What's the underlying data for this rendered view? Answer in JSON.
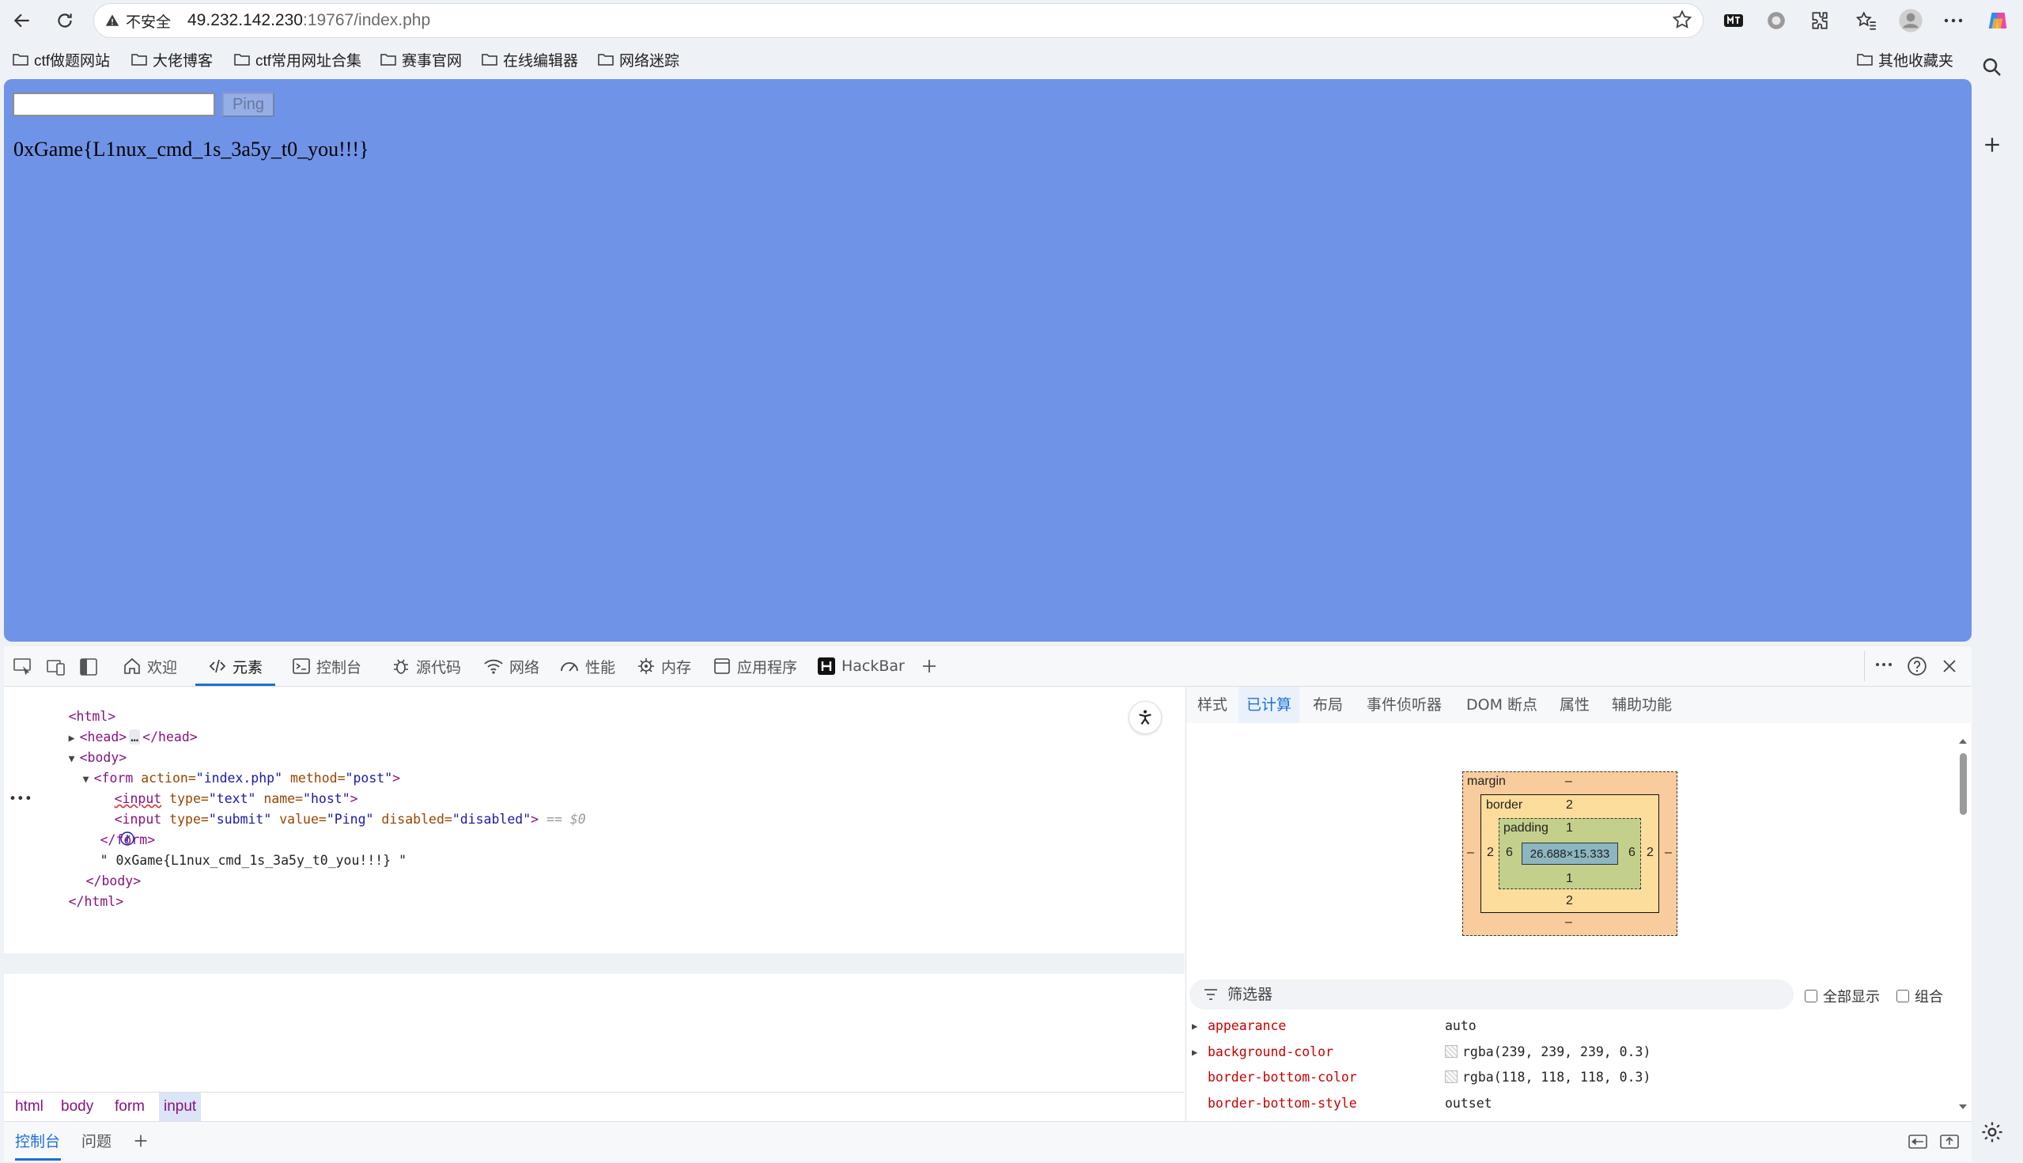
{
  "browser": {
    "security_label": "不安全",
    "url_host": "49.232.142.230",
    "url_path": ":19767/index.php",
    "bookmarks": [
      "ctf做题网站",
      "大佬博客",
      "ctf常用网址合集",
      "赛事官网",
      "在线编辑器",
      "网络迷踪"
    ],
    "other_bookmarks": "其他收藏夹",
    "icons": [
      "back-icon",
      "reload-icon",
      "warning-icon",
      "star-icon",
      "extensions-icon",
      "favorites-icon",
      "profile-icon",
      "more-icon",
      "copilot-icon",
      "search-icon",
      "plus-icon"
    ]
  },
  "page": {
    "input_value": "",
    "ping_label": "Ping",
    "flag_text": "0xGame{L1nux_cmd_1s_3a5y_t0_you!!!}",
    "background_color": "#6f93e6"
  },
  "devtools": {
    "tabs": [
      {
        "label": "欢迎",
        "icon": "home-icon"
      },
      {
        "label": "元素",
        "icon": "code-icon"
      },
      {
        "label": "控制台",
        "icon": "console-icon"
      },
      {
        "label": "源代码",
        "icon": "bug-icon"
      },
      {
        "label": "网络",
        "icon": "wifi-icon"
      },
      {
        "label": "性能",
        "icon": "gauge-icon"
      },
      {
        "label": "内存",
        "icon": "memory-icon"
      },
      {
        "label": "应用程序",
        "icon": "app-icon"
      },
      {
        "label": "HackBar",
        "icon": "hackbar-icon"
      }
    ],
    "dom": {
      "l0": "<html>",
      "l1_open": "<head>",
      "l1_ellipsis": "…",
      "l1_close": "</head>",
      "l2": "<body>",
      "form_tag_open": "<form",
      "form_attr1": " action=",
      "form_val1": "\"index.php\"",
      "form_attr2": " method=",
      "form_val2": "\"post\"",
      "form_tag_close": ">",
      "in1_tag": "<input",
      "in1_attr1": " type=",
      "in1_val1": "\"text\"",
      "in1_attr2": " name=",
      "in1_val2": "\"host\"",
      "in1_close": ">",
      "in2_tag": "<input",
      "in2_attr1": " type=",
      "in2_val1": "\"submit\"",
      "in2_attr2": " value=",
      "in2_val2": "\"Ping\"",
      "in2_attr3": " disabled=",
      "in2_val3": "\"disabled\"",
      "in2_close": ">",
      "in2_dollar": " == $0",
      "form_end": "</form>",
      "text_node": "\" 0xGame{L1nux_cmd_1s_3a5y_t0_you!!!} \"",
      "body_end": "</body>",
      "html_end": "</html>",
      "more": "•••"
    },
    "breadcrumb": [
      "html",
      "body",
      "form",
      "input"
    ],
    "drawer_tabs": [
      "控制台",
      "问题"
    ],
    "side_tabs": [
      "样式",
      "已计算",
      "布局",
      "事件侦听器",
      "DOM 断点",
      "属性",
      "辅助功能"
    ],
    "box_model": {
      "margin_label": "margin",
      "margin_top": "–",
      "margin_bottom": "–",
      "margin_left": "–",
      "margin_right": "–",
      "border_label": "border",
      "border_top": "2",
      "border_bottom": "2",
      "border_left": "2",
      "border_right": "2",
      "padding_label": "padding",
      "padding_top": "1",
      "padding_bottom": "1",
      "padding_left": "6",
      "padding_right": "6",
      "content": "26.688×15.333"
    },
    "filter_placeholder": "筛选器",
    "show_all": "全部显示",
    "group": "组合",
    "computed": [
      {
        "name": "appearance",
        "value": "auto",
        "expandable": true
      },
      {
        "name": "background-color",
        "value": "rgba(239, 239, 239, 0.3)",
        "expandable": true
      },
      {
        "name": "border-bottom-color",
        "value": "rgba(118, 118, 118, 0.3)",
        "expandable": false
      },
      {
        "name": "border-bottom-style",
        "value": "outset",
        "expandable": false
      }
    ]
  }
}
